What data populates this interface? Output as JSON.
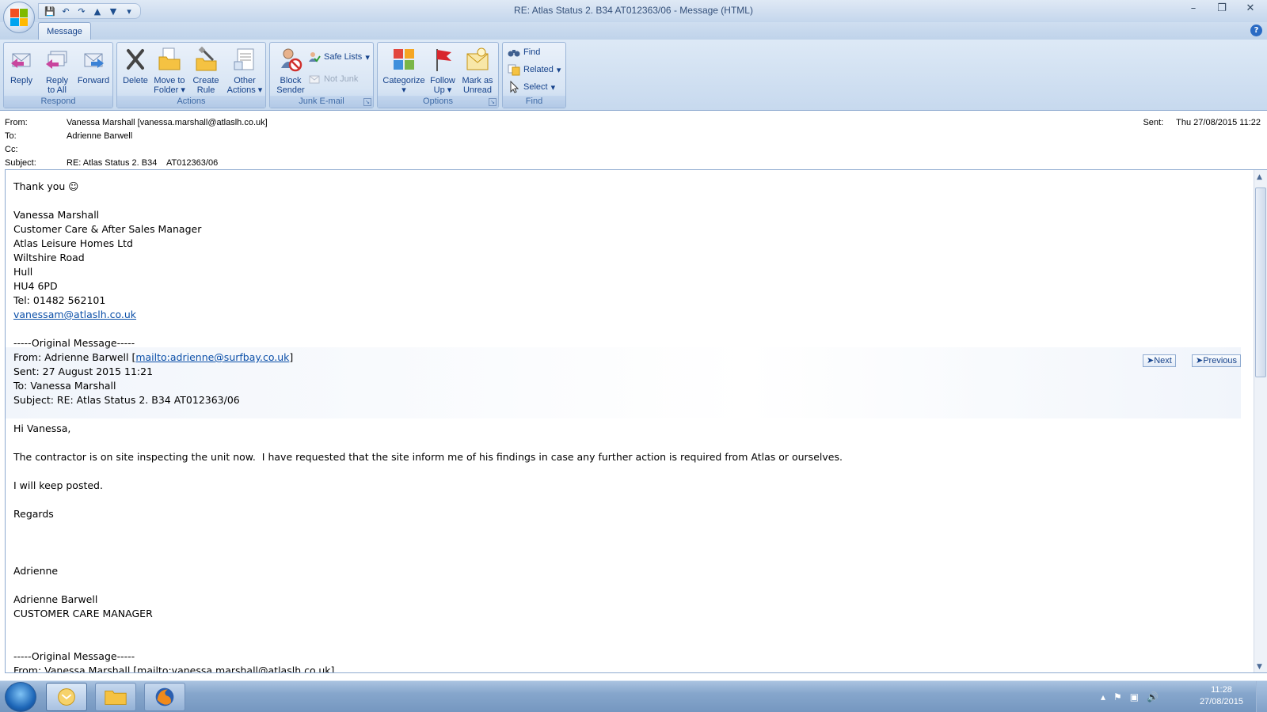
{
  "window": {
    "title": "RE: Atlas Status 2. B34    AT012363/06 - Message (HTML)",
    "controls": [
      "minimize",
      "restore",
      "close"
    ]
  },
  "quick_access": {
    "icons": [
      "save-icon",
      "undo-icon",
      "redo-icon",
      "previous-item-icon",
      "next-item-icon",
      "customize-icon"
    ]
  },
  "ribbon": {
    "active_tab": "Message",
    "groups": {
      "respond": {
        "label": "Respond",
        "reply": "Reply",
        "reply_all_1": "Reply",
        "reply_all_2": "to All",
        "forward": "Forward"
      },
      "actions": {
        "label": "Actions",
        "delete": "Delete",
        "move_1": "Move to",
        "move_2": "Folder",
        "create_1": "Create",
        "create_2": "Rule",
        "other_1": "Other",
        "other_2": "Actions"
      },
      "junk": {
        "label": "Junk E-mail",
        "block_1": "Block",
        "block_2": "Sender",
        "safe_lists": "Safe Lists",
        "not_junk": "Not Junk"
      },
      "options": {
        "label": "Options",
        "categorize": "Categorize",
        "follow_1": "Follow",
        "follow_2": "Up",
        "mark_1": "Mark as",
        "mark_2": "Unread"
      },
      "find": {
        "label": "Find",
        "find": "Find",
        "related": "Related",
        "select": "Select"
      }
    }
  },
  "header": {
    "from_label": "From:",
    "from_value": "Vanessa Marshall [vanessa.marshall@atlaslh.co.uk]",
    "to_label": "To:",
    "to_value": "Adrienne Barwell",
    "cc_label": "Cc:",
    "cc_value": "",
    "subject_label": "Subject:",
    "subject_value": "RE: Atlas Status 2. B34    AT012363/06",
    "sent_label": "Sent:",
    "sent_value": "Thu 27/08/2015 11:22"
  },
  "body": {
    "greeting": "Thank you ☺",
    "sig_name": "Vanessa Marshall",
    "sig_title": "Customer Care & After Sales Manager",
    "sig_company": "Atlas Leisure Homes Ltd",
    "sig_road": "Wiltshire Road",
    "sig_city": "Hull",
    "sig_postcode": "HU4 6PD",
    "sig_tel": "Tel: 01482 562101",
    "sig_email": "vanessam@atlaslh.co.uk",
    "orig_separator": "-----Original Message-----",
    "orig_from_prefix": "From: Adrienne Barwell [",
    "orig_from_link": "mailto:adrienne@surfbay.co.uk",
    "orig_from_suffix": "]",
    "orig_sent": "Sent: 27 August 2015 11:21",
    "orig_to": "To: Vanessa Marshall",
    "orig_subject": "Subject: RE: Atlas Status 2. B34 AT012363/06",
    "orig_greeting": "Hi Vanessa,",
    "orig_line1": "The contractor is on site inspecting the unit now.  I have requested that the site inform me of his findings in case any further action is required from Atlas or ourselves.",
    "orig_line2": "I will keep posted.",
    "orig_regards": "Regards",
    "orig_name": "Adrienne",
    "orig_sig_name": "Adrienne Barwell",
    "orig_sig_title": "CUSTOMER CARE MANAGER",
    "orig2_separator": "-----Original Message-----",
    "orig2_from_partial": "From: Vanessa Marshall [mailto:vanessa.marshall@atlaslh.co.uk]",
    "nav_next": "Next",
    "nav_previous": "Previous"
  },
  "taskbar": {
    "clock_time": "11:28",
    "clock_date": "27/08/2015",
    "apps": [
      "outlook-icon",
      "file-explorer-icon",
      "firefox-icon"
    ]
  },
  "colors": {
    "ribbon_text": "#15428b",
    "link": "#0b4fa8",
    "taskbar": "#86a6cc"
  }
}
